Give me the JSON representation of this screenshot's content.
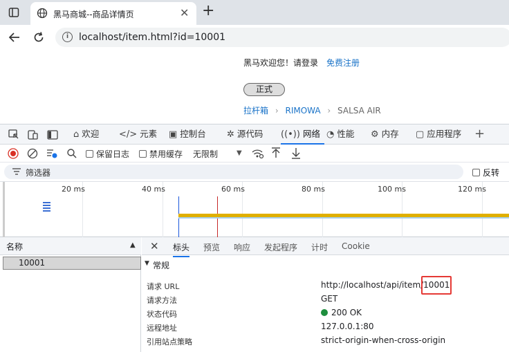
{
  "browser": {
    "tab_title": "黑马商城--商品详情页",
    "close_glyph": "✕",
    "newtab_glyph": "+",
    "url": "localhost/item.html?id=10001"
  },
  "page": {
    "welcome": "黑马欢迎您！请登录",
    "register": "免费注册",
    "badge": "正式",
    "breadcrumb": [
      "拉杆箱",
      "RIMOWA",
      "SALSA AIR"
    ],
    "crumb_sep": "›"
  },
  "devtools": {
    "tabs": [
      {
        "icon": "home-icon",
        "label": "欢迎"
      },
      {
        "icon": "code-icon",
        "label": "元素"
      },
      {
        "icon": "console-icon",
        "label": "控制台"
      },
      {
        "icon": "bug-icon",
        "label": "源代码"
      },
      {
        "icon": "wifi-icon",
        "label": "网络"
      },
      {
        "icon": "gauge-icon",
        "label": "性能"
      },
      {
        "icon": "gear-icon",
        "label": "内存"
      },
      {
        "icon": "app-icon",
        "label": "应用程序"
      }
    ],
    "toolbar": {
      "preserve_log": "保留日志",
      "disable_cache": "禁用缓存",
      "throttle": "无限制"
    },
    "filter_label": "筛选器",
    "invert_label": "反转",
    "timeline_ticks": [
      "20 ms",
      "40 ms",
      "60 ms",
      "80 ms",
      "100 ms",
      "120 ms"
    ],
    "name_header": "名称",
    "request_name": "10001",
    "detail_tabs": [
      "标头",
      "预览",
      "响应",
      "发起程序",
      "计时",
      "Cookie"
    ],
    "general_title": "常规",
    "general": [
      {
        "k": "请求 URL",
        "v": "http://localhost/api/item/10001"
      },
      {
        "k": "请求方法",
        "v": "GET"
      },
      {
        "k": "状态代码",
        "v": "200 OK"
      },
      {
        "k": "远程地址",
        "v": "127.0.0.1:80"
      },
      {
        "k": "引用站点策略",
        "v": "strict-origin-when-cross-origin"
      }
    ],
    "status_color": "#1e8e3e",
    "accent": "#1a73e8"
  }
}
